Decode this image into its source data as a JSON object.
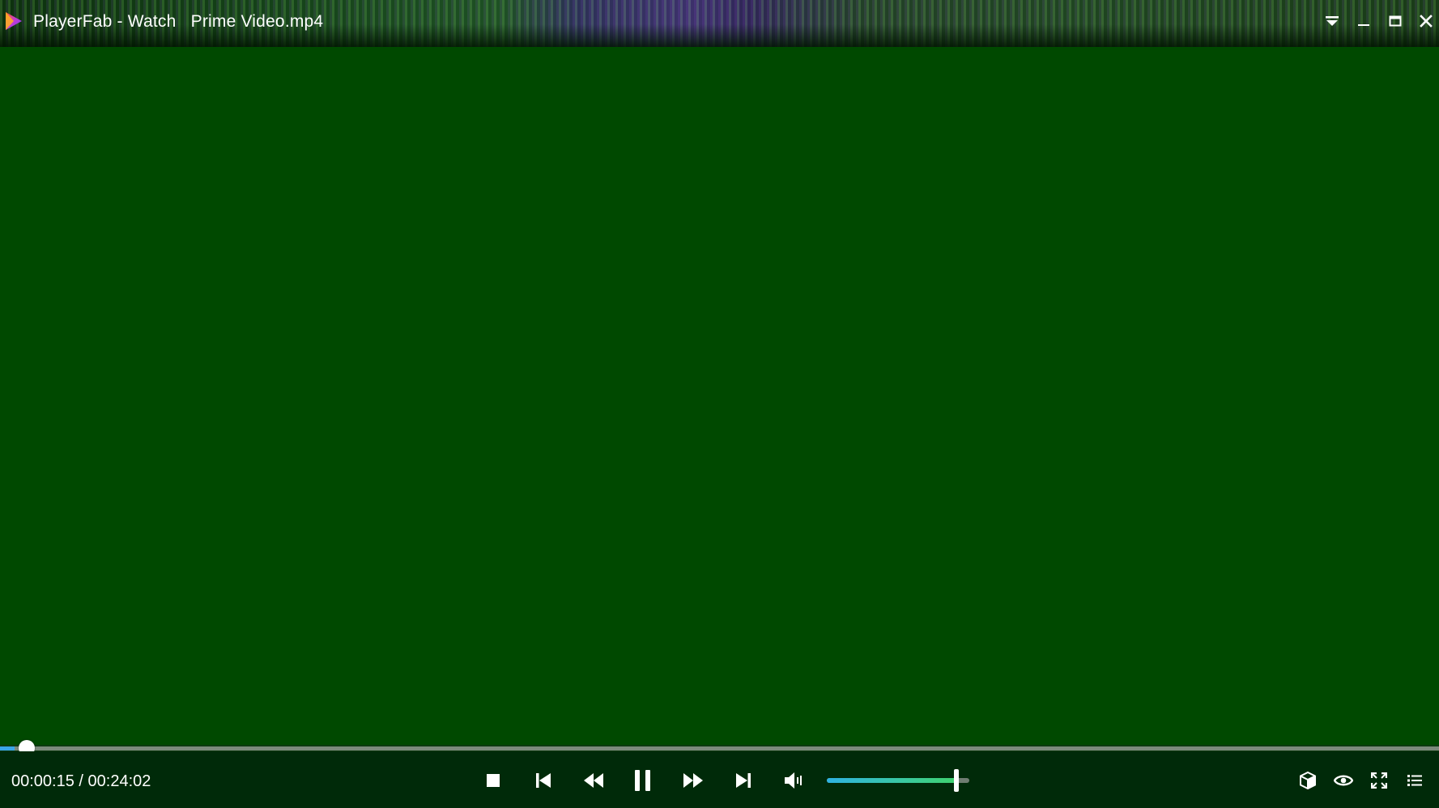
{
  "window": {
    "title": "PlayerFab - Watch   Prime Video.mp4",
    "app_icon": "playerfab-logo-icon",
    "buttons": [
      "dropdown-menu-icon",
      "minimize-icon",
      "maximize-icon",
      "close-icon"
    ]
  },
  "playback": {
    "time_display": "00:00:15 / 00:24:02",
    "position_fraction": 0.0104,
    "state": "playing"
  },
  "controls": {
    "icons": [
      "stop-icon",
      "previous-icon",
      "rewind-icon",
      "pause-icon",
      "fast-forward-icon",
      "next-icon",
      "volume-icon"
    ]
  },
  "volume": {
    "level_fraction": 0.91
  },
  "right_tools": {
    "icons": [
      "3d-box-icon",
      "eye-icon",
      "fullscreen-icon",
      "playlist-icon"
    ]
  },
  "colors": {
    "video_background": "#004900",
    "seek_fill": "#3aa6e8",
    "volume_fill_start": "#2fb2e2",
    "volume_fill_end": "#3fd26e"
  }
}
